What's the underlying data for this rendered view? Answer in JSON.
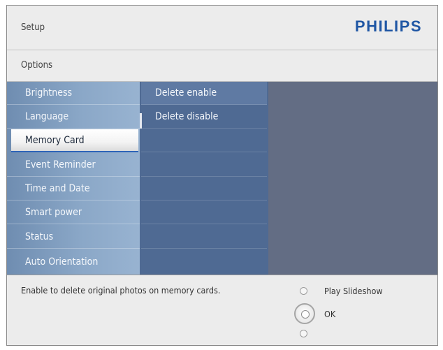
{
  "header": {
    "title": "Setup",
    "brand": "PHILIPS",
    "section": "Options"
  },
  "menu": {
    "items": [
      "Brightness",
      "Language",
      "Memory Card",
      "Event Reminder",
      "Time and Date",
      "Smart power",
      "Status",
      "Auto Orientation"
    ],
    "selected": "Memory Card"
  },
  "submenu": {
    "items": [
      "Delete enable",
      "Delete disable"
    ],
    "highlighted": "Delete enable"
  },
  "footer": {
    "help": "Enable to delete original photos on memory cards.",
    "hints": {
      "up": "Play Slideshow",
      "center": "OK"
    }
  },
  "colors": {
    "brand": "#1f56a4",
    "selection_underline": "#2e64b8"
  }
}
